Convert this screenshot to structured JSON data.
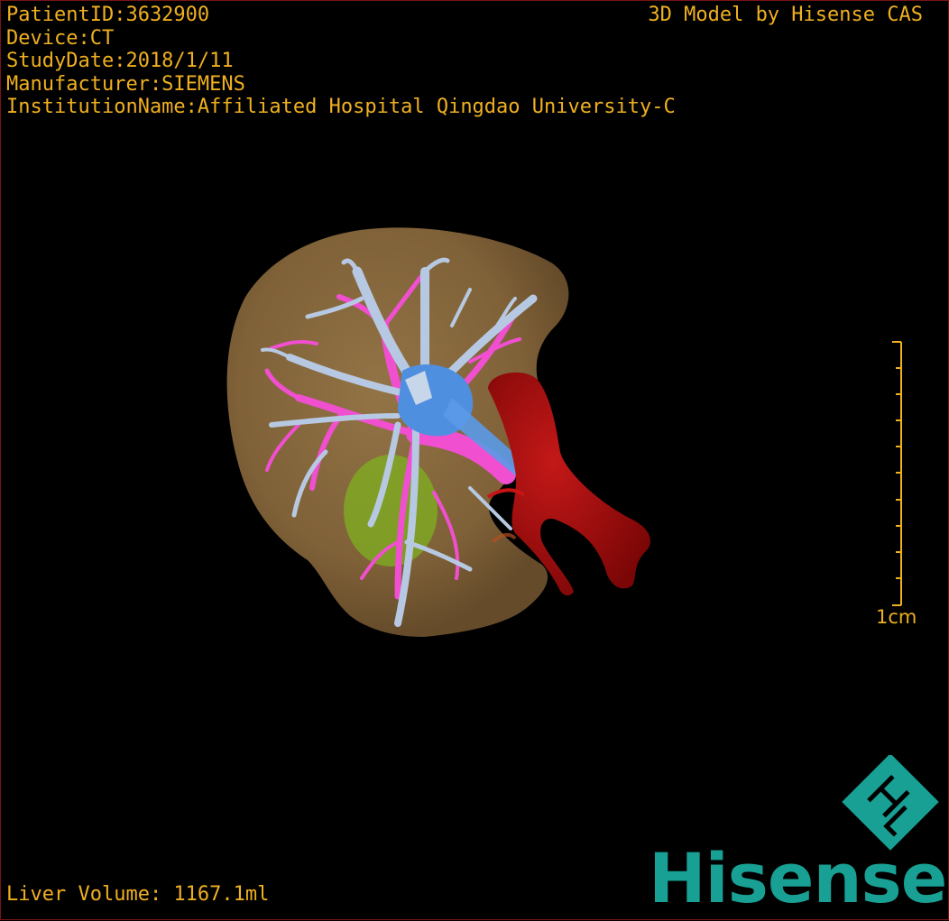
{
  "patient": {
    "id_line": "PatientID:3632900",
    "device_line": "Device:CT",
    "study_date_line": "StudyDate:2018/1/11",
    "manufacturer_line": "Manufacturer:SIEMENS",
    "institution_line": "InstitutionName:Affiliated Hospital Qingdao University-C"
  },
  "brand_caption": "3D Model by Hisense CAS",
  "measurements": {
    "liver_volume_line": "Liver Volume: 1167.1ml"
  },
  "scale": {
    "label": "1cm"
  },
  "logo": {
    "wordmark": "Hisense",
    "monogram": "HL"
  },
  "colors": {
    "overlay_text": "#f0b020",
    "liver": "#8a6a3e",
    "hepatic_vein": "#b7c9e2",
    "portal_vein": "#f04fd0",
    "vena_cava": "#4f8fe0",
    "aorta": "#a80c0c",
    "gallbladder": "#7fb020",
    "brand": "#17a093"
  }
}
